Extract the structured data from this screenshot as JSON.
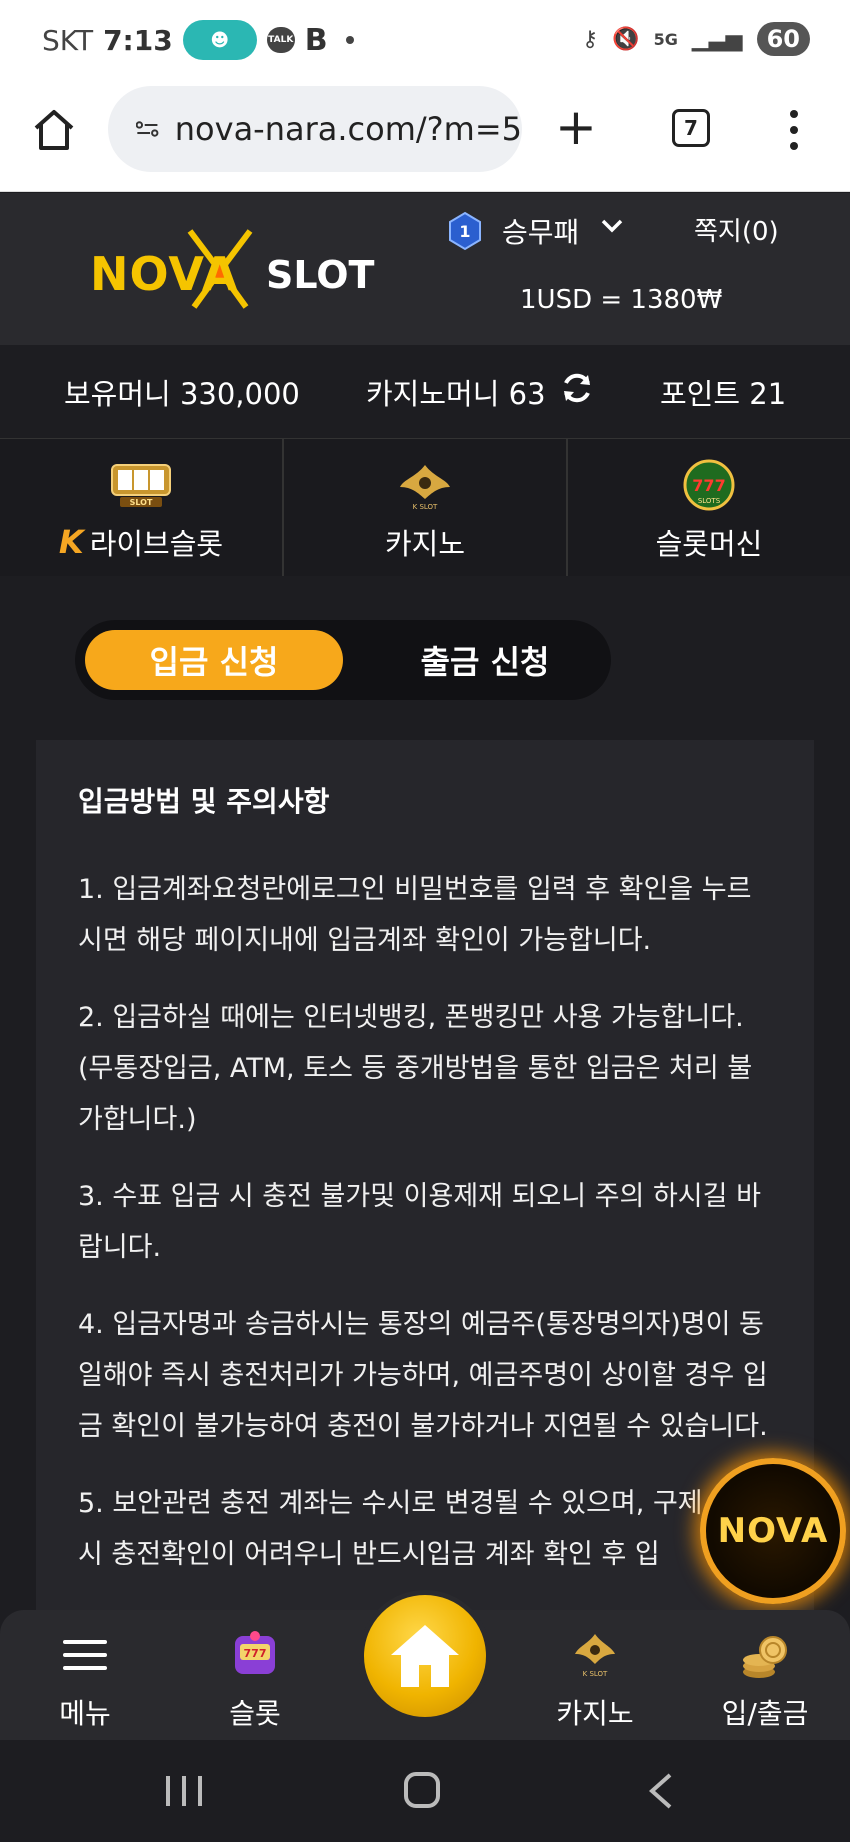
{
  "status_bar": {
    "carrier": "SKT",
    "time": "7:13",
    "talk": "TALK",
    "b_icon": "B",
    "network": "5G",
    "battery": "60"
  },
  "browser": {
    "url": "nova-nara.com/?m=5",
    "tab_count": "7"
  },
  "header": {
    "logo_main": "NOVA",
    "logo_sub": "SLOT",
    "level": "1",
    "username": "승무패",
    "notes": "쪽지(0)",
    "rate": "1USD = 1380₩"
  },
  "balances": {
    "money": "보유머니 330,000",
    "casino": "카지노머니 63",
    "point": "포인트 21"
  },
  "categories": [
    {
      "label": "라이브슬롯",
      "icon": "live-slot-icon",
      "prefix": "K"
    },
    {
      "label": "카지노",
      "icon": "k-slot-icon"
    },
    {
      "label": "슬롯머신",
      "icon": "777-slots-icon"
    }
  ],
  "toggle": {
    "deposit": "입금 신청",
    "withdraw": "출금 신청"
  },
  "notice": {
    "title": "입금방법 및 주의사항",
    "items": [
      "1. 입금계좌요청란에로그인 비밀번호를 입력 후 확인을 누르시면 해당 페이지내에 입금계좌 확인이 가능합니다.",
      "2. 입금하실 때에는 인터넷뱅킹, 폰뱅킹만 사용 가능합니다.(무통장입금, ATM, 토스 등 중개방법을 통한 입금은 처리 불가합니다.)",
      "3. 수표 입금 시 충전 불가및 이용제재 되오니 주의 하시길 바랍니다.",
      "4. 입금자명과 송금하시는 통장의 예금주(통장명의자)명이 동일해야 즉시 충전처리가 가능하며, 예금주명이 상이할 경우 입금 확인이 불가능하여 충전이 불가하거나 지연될 수 있습니다.",
      "5. 보안관련 충전 계좌는 수시로 변경될 수 있으며, 구제 입금 시 충전확인이 어려우니 반드시입금 계좌 확인 후 입"
    ]
  },
  "fab_label": "NOVA",
  "bottom_nav": {
    "menu": "메뉴",
    "slot": "슬롯",
    "casino": "카지노",
    "bank": "입/출금"
  },
  "colors": {
    "accent": "#f7a81b",
    "logo_yellow": "#f5c400",
    "bg": "#1d1d21",
    "panel": "#26262b"
  }
}
